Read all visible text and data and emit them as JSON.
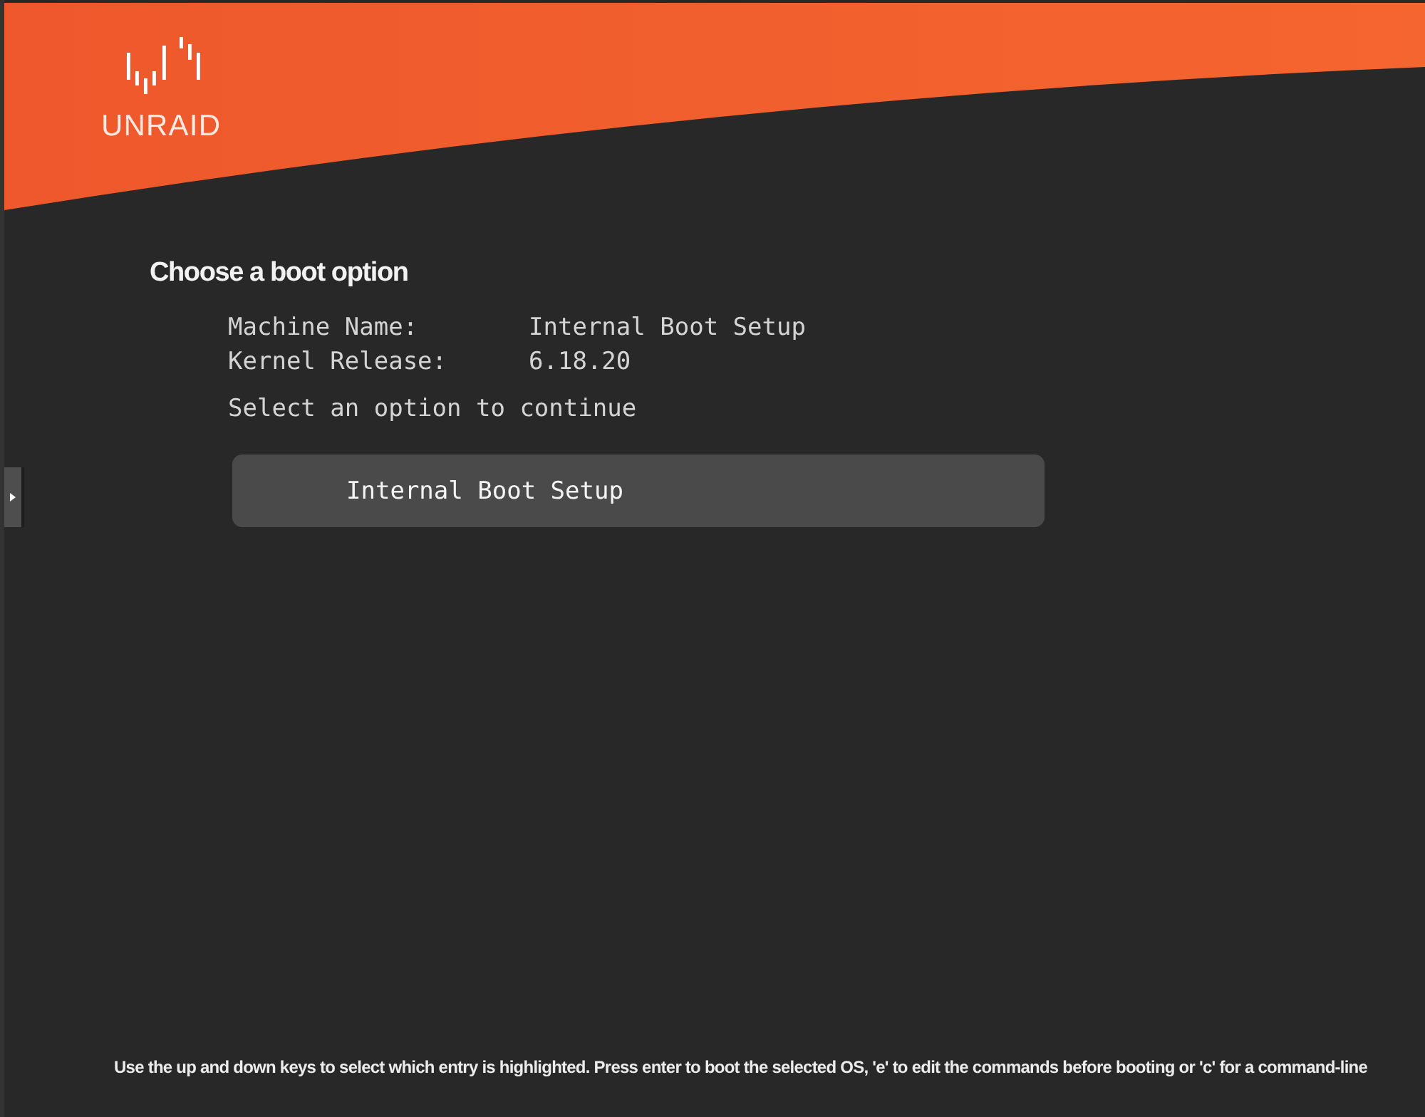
{
  "header": {
    "logo_text": "UNRAID"
  },
  "title": "Choose a boot option",
  "info": [
    {
      "label": "Machine Name:",
      "value": "Internal Boot Setup"
    },
    {
      "label": "Kernel Release:",
      "value": "6.18.20"
    }
  ],
  "prompt": "Select an option to continue",
  "menu": [
    {
      "label": "Internal Boot Setup",
      "selected": true
    }
  ],
  "footer": "Use the up and down keys to select which entry is highlighted. Press enter to boot the selected OS, 'e' to edit the commands before booting or 'c' for a command-line"
}
